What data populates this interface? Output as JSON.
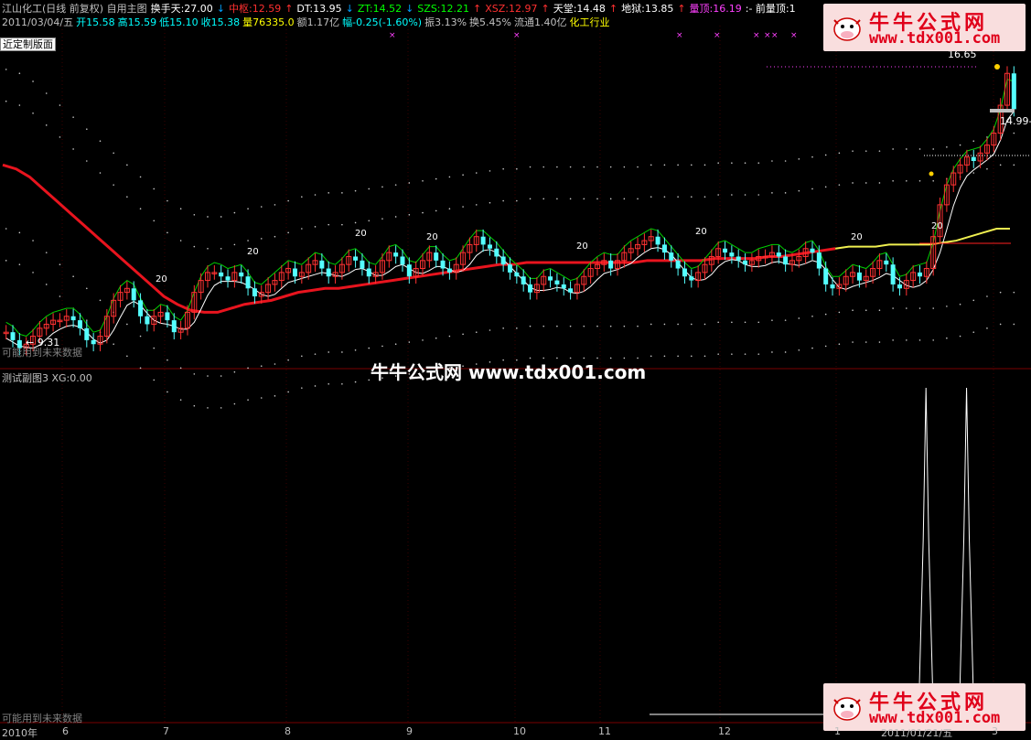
{
  "header": {
    "row1": [
      {
        "text": "江山化工(日线 前复权) 自用主图",
        "color": "#c0c0c0"
      },
      {
        "text": "换手天:27.00",
        "color": "#ffffff"
      },
      {
        "text": "↓",
        "color": "#00a0ff"
      },
      {
        "text": "中枢:12.59",
        "color": "#ff3030"
      },
      {
        "text": "↑",
        "color": "#ff3030"
      },
      {
        "text": "DT:13.95",
        "color": "#ffffff"
      },
      {
        "text": "↓",
        "color": "#00a0ff"
      },
      {
        "text": "ZT:14.52",
        "color": "#00ff00"
      },
      {
        "text": "↓",
        "color": "#00a0ff"
      },
      {
        "text": "SZS:12.21",
        "color": "#00ff00"
      },
      {
        "text": "↑",
        "color": "#ff3030"
      },
      {
        "text": "XSZ:12.97",
        "color": "#ff3030"
      },
      {
        "text": "↑",
        "color": "#ff3030"
      },
      {
        "text": "天堂:14.48",
        "color": "#ffffff"
      },
      {
        "text": "↑",
        "color": "#ff3030"
      },
      {
        "text": "地狱:13.85",
        "color": "#ffffff"
      },
      {
        "text": "↑",
        "color": "#ff3030"
      },
      {
        "text": "量顶:16.19",
        "color": "#ff40ff"
      },
      {
        "text": ":- 前量顶:1",
        "color": "#ffffff"
      }
    ],
    "row2": [
      {
        "text": "2011/03/04/五",
        "color": "#c0c0c0"
      },
      {
        "text": "开15.58",
        "color": "#00ffff"
      },
      {
        "text": "高15.59",
        "color": "#00ffff"
      },
      {
        "text": "低15.10",
        "color": "#00ffff"
      },
      {
        "text": "收15.38",
        "color": "#00ffff"
      },
      {
        "text": "量76335.0",
        "color": "#ffff00"
      },
      {
        "text": "额1.17亿",
        "color": "#c0c0c0"
      },
      {
        "text": "幅-0.25(-1.60%)",
        "color": "#00ffff"
      },
      {
        "text": "振3.13%",
        "color": "#c0c0c0"
      },
      {
        "text": "换5.45%",
        "color": "#c0c0c0"
      },
      {
        "text": "流通1.40亿",
        "color": "#c0c0c0"
      },
      {
        "text": "化工行业",
        "color": "#ffff00"
      }
    ]
  },
  "panel_button": "近定制版面",
  "sub_panel_label": "测试副图3  XG:0.00",
  "future_data_warning_main": "可能用到未来数据",
  "future_data_warning_sub": "可能用到未来数据",
  "watermark_center": "牛牛公式网 www.tdx001.com",
  "watermark_box": {
    "title": "牛牛公式网",
    "url": "www.tdx001.com"
  },
  "colors": {
    "up": "#ff3232",
    "down": "#54ffff",
    "ma_red": "#e8141e",
    "ma_yellow": "#f0f050",
    "line_white": "#ffffff",
    "line_green": "#00d000",
    "dots": "#c8c8c8",
    "magenta": "#ff40ff",
    "grid_red": "#7a0000"
  },
  "chart_data": [
    {
      "type": "candlestick",
      "title": "江山化工(日线 前复权)",
      "ylim": [
        9.0,
        17.5
      ],
      "annotations": [
        {
          "label": "← 9.31",
          "value": 9.31
        },
        {
          "label": "16.65",
          "value": 16.65
        },
        {
          "label": "14.99-1",
          "value": 14.99
        },
        {
          "label": "20",
          "value": 20
        }
      ],
      "x_labels": [
        "2010年",
        "6",
        "7",
        "8",
        "9",
        "10",
        "11",
        "12",
        "1",
        "2011/01/21/五",
        "3"
      ],
      "series": [
        {
          "name": "price",
          "values": [
            9.8,
            9.6,
            9.4,
            9.5,
            9.7,
            9.9,
            10.0,
            10.1,
            10.1,
            10.2,
            10.1,
            9.9,
            9.6,
            9.5,
            9.7,
            10.2,
            10.6,
            10.8,
            10.9,
            10.6,
            10.2,
            10.0,
            10.2,
            10.3,
            10.1,
            9.8,
            9.9,
            10.3,
            10.8,
            11.1,
            11.3,
            11.3,
            11.2,
            11.1,
            11.3,
            11.2,
            10.9,
            10.7,
            10.8,
            11.0,
            11.1,
            11.3,
            11.4,
            11.2,
            11.3,
            11.5,
            11.6,
            11.4,
            11.2,
            11.3,
            11.5,
            11.7,
            11.6,
            11.4,
            11.2,
            11.3,
            11.6,
            11.8,
            11.7,
            11.5,
            11.2,
            11.4,
            11.6,
            11.8,
            11.6,
            11.4,
            11.3,
            11.5,
            11.8,
            12.0,
            12.2,
            12.0,
            11.9,
            11.7,
            11.5,
            11.3,
            11.2,
            11.0,
            10.8,
            11.0,
            11.2,
            11.1,
            11.0,
            10.9,
            10.8,
            11.0,
            11.2,
            11.4,
            11.5,
            11.6,
            11.4,
            11.6,
            11.8,
            11.9,
            12.0,
            12.1,
            12.2,
            12.0,
            11.8,
            11.6,
            11.4,
            11.2,
            11.1,
            11.3,
            11.5,
            11.7,
            11.9,
            11.8,
            11.7,
            11.6,
            11.5,
            11.6,
            11.7,
            11.7,
            11.8,
            11.7,
            11.5,
            11.6,
            11.7,
            11.9,
            11.8,
            11.4,
            11.0,
            10.9,
            11.0,
            11.2,
            11.3,
            11.1,
            11.2,
            11.4,
            11.6,
            11.5,
            11.0,
            10.9,
            11.1,
            11.3,
            11.2,
            11.4,
            12.2,
            13.0,
            13.5,
            13.8,
            14.0,
            14.2,
            14.1,
            14.3,
            14.5,
            14.8,
            15.5,
            16.3,
            15.4
          ]
        },
        {
          "name": "MA",
          "values": [
            14.0,
            13.9,
            13.7,
            13.4,
            13.1,
            12.8,
            12.5,
            12.2,
            11.9,
            11.6,
            11.3,
            11.0,
            10.7,
            10.5,
            10.35,
            10.3,
            10.3,
            10.4,
            10.5,
            10.55,
            10.6,
            10.7,
            10.8,
            10.85,
            10.9,
            10.9,
            10.95,
            11.0,
            11.05,
            11.1,
            11.15,
            11.2,
            11.25,
            11.3,
            11.35,
            11.4,
            11.45,
            11.5,
            11.5,
            11.55,
            11.55,
            11.55,
            11.55,
            11.55,
            11.55,
            11.55,
            11.55,
            11.55,
            11.6,
            11.6,
            11.6,
            11.6,
            11.6,
            11.65,
            11.65,
            11.65,
            11.65,
            11.7,
            11.7,
            11.75,
            11.8,
            11.85,
            11.9,
            11.95,
            11.95,
            11.95,
            12.0,
            12.0,
            12.0,
            12.0,
            12.05,
            12.1,
            12.2,
            12.3,
            12.4,
            12.4
          ]
        },
        {
          "name": "XG",
          "values": [
            0,
            0,
            0,
            0,
            0,
            0,
            0,
            0,
            0,
            0,
            0,
            0,
            0,
            0,
            0,
            0,
            0,
            0,
            0,
            0,
            0,
            0,
            0,
            0,
            0,
            0,
            0,
            0,
            0,
            0,
            0,
            0,
            0,
            0,
            0,
            0,
            0,
            0,
            0,
            0,
            0,
            0,
            0,
            0,
            0,
            0,
            0,
            0,
            0,
            0,
            0,
            0,
            0,
            0,
            0,
            0,
            0,
            0,
            0,
            0,
            0,
            0,
            0,
            0,
            0,
            0,
            0,
            0,
            0,
            0,
            0,
            0,
            0,
            0,
            0,
            0,
            0,
            0,
            0,
            0,
            0,
            0,
            0,
            0,
            0,
            0,
            0,
            0,
            0,
            0,
            0,
            0,
            0,
            0,
            0,
            0,
            0,
            0,
            0,
            0,
            0,
            0,
            0,
            0,
            0,
            0,
            0,
            0,
            0,
            0,
            0,
            0,
            0,
            0,
            0,
            0,
            0,
            0,
            0,
            0,
            0,
            0,
            0,
            0,
            0,
            0,
            0,
            0,
            0,
            0,
            0,
            0,
            0,
            0,
            0,
            0,
            1,
            0,
            0,
            0,
            0,
            0,
            1,
            0,
            0,
            0,
            0,
            0,
            0,
            0
          ]
        }
      ]
    }
  ]
}
